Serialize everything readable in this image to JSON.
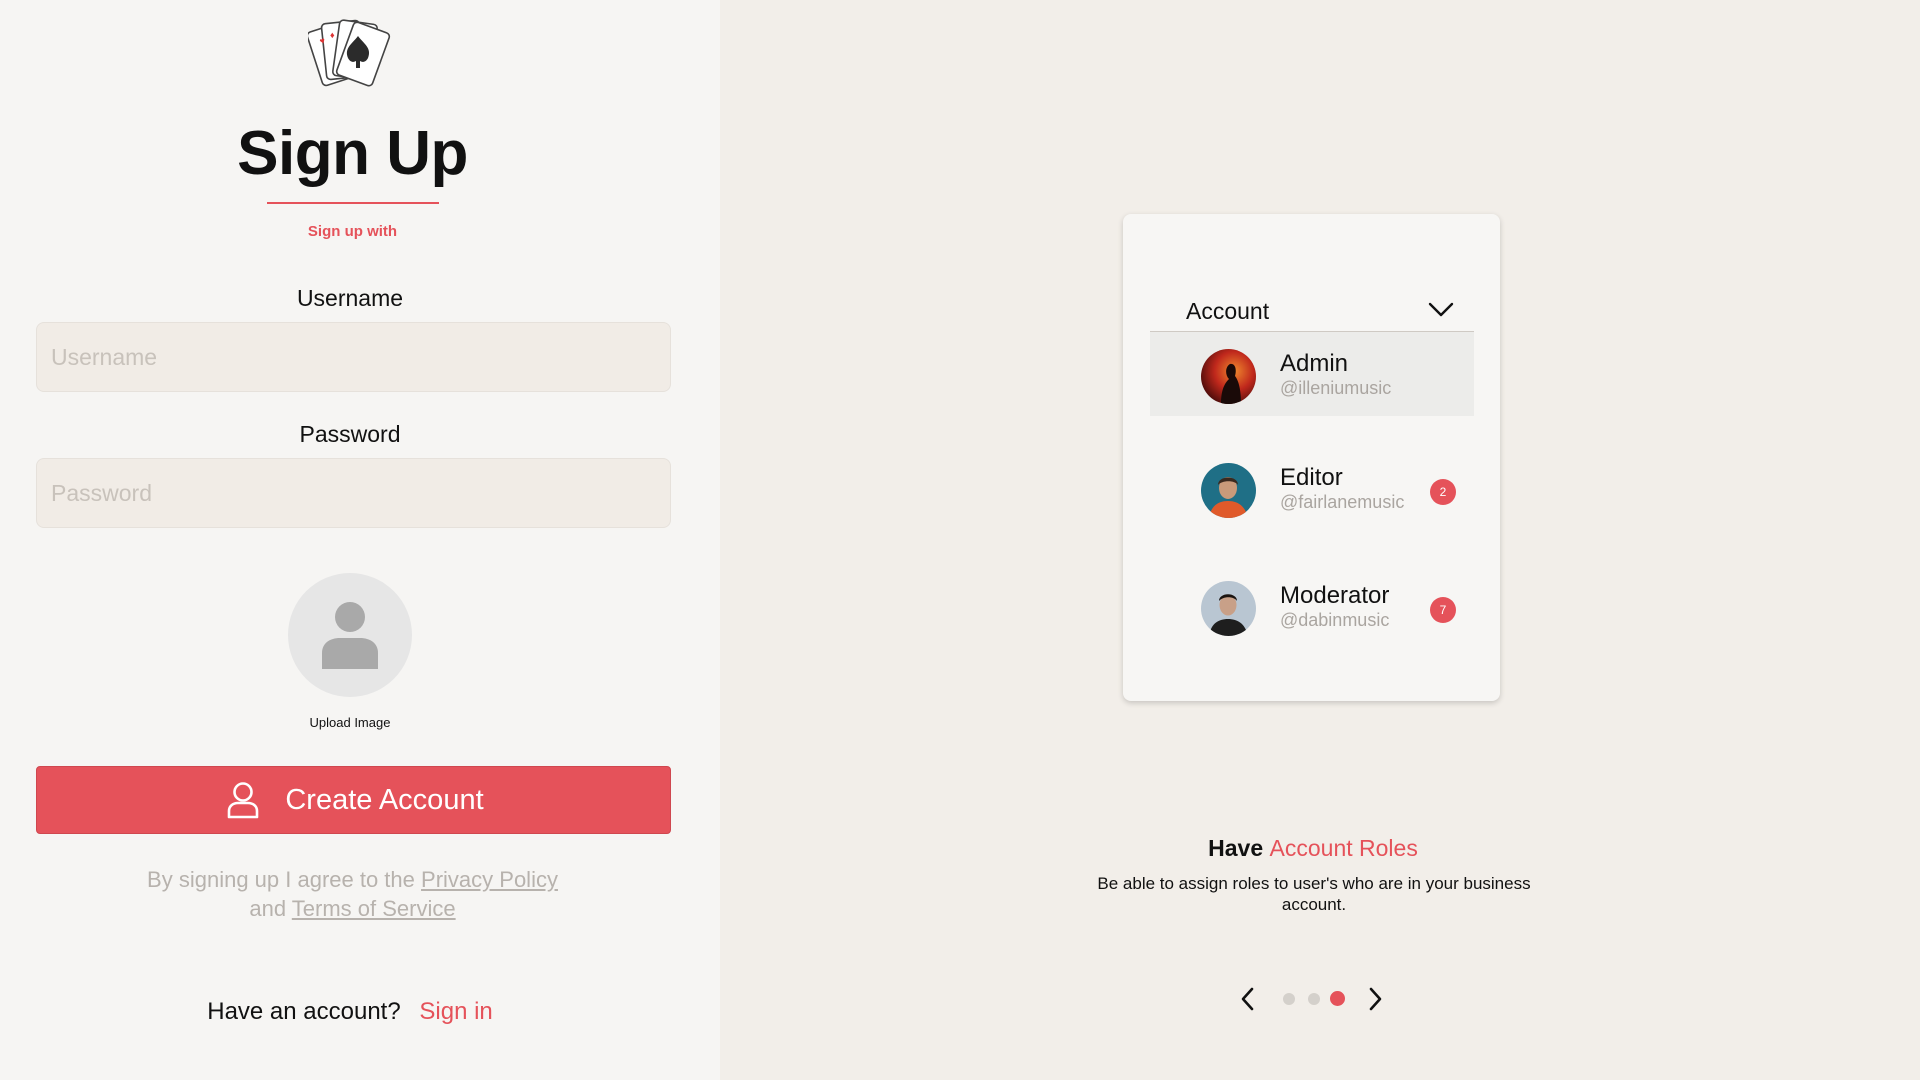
{
  "signup": {
    "title": "Sign Up",
    "subtitle": "Sign up with",
    "username_label": "Username",
    "username_placeholder": "Username",
    "password_label": "Password",
    "password_placeholder": "Password",
    "upload_label": "Upload Image",
    "create_button": "Create Account",
    "terms_prefix": "By signing up I agree to the",
    "privacy_link": "Privacy Policy",
    "terms_and": "and",
    "terms_link": "Terms of Service",
    "have_account": "Have an account?",
    "signin_link": "Sign in"
  },
  "preview": {
    "dropdown_label": "Account",
    "roles": [
      {
        "name": "Admin",
        "handle": "@illeniumusic",
        "badge": ""
      },
      {
        "name": "Editor",
        "handle": "@fairlanemusic",
        "badge": "2"
      },
      {
        "name": "Moderator",
        "handle": "@dabinmusic",
        "badge": "7"
      }
    ],
    "feature_prefix": "Have",
    "feature_accent": "Account Roles",
    "feature_desc": "Be able to assign roles to user's who are in your business account."
  },
  "carousel": {
    "current_slide": 3,
    "total_slides": 3
  },
  "colors": {
    "accent": "#e5525a",
    "left_bg": "#f6f5f3",
    "right_bg": "#f2eee9"
  },
  "icons": [
    "playing-cards-logo",
    "user-placeholder-icon",
    "user-outline-icon",
    "chevron-down-icon",
    "arrow-left-icon",
    "arrow-right-icon"
  ]
}
